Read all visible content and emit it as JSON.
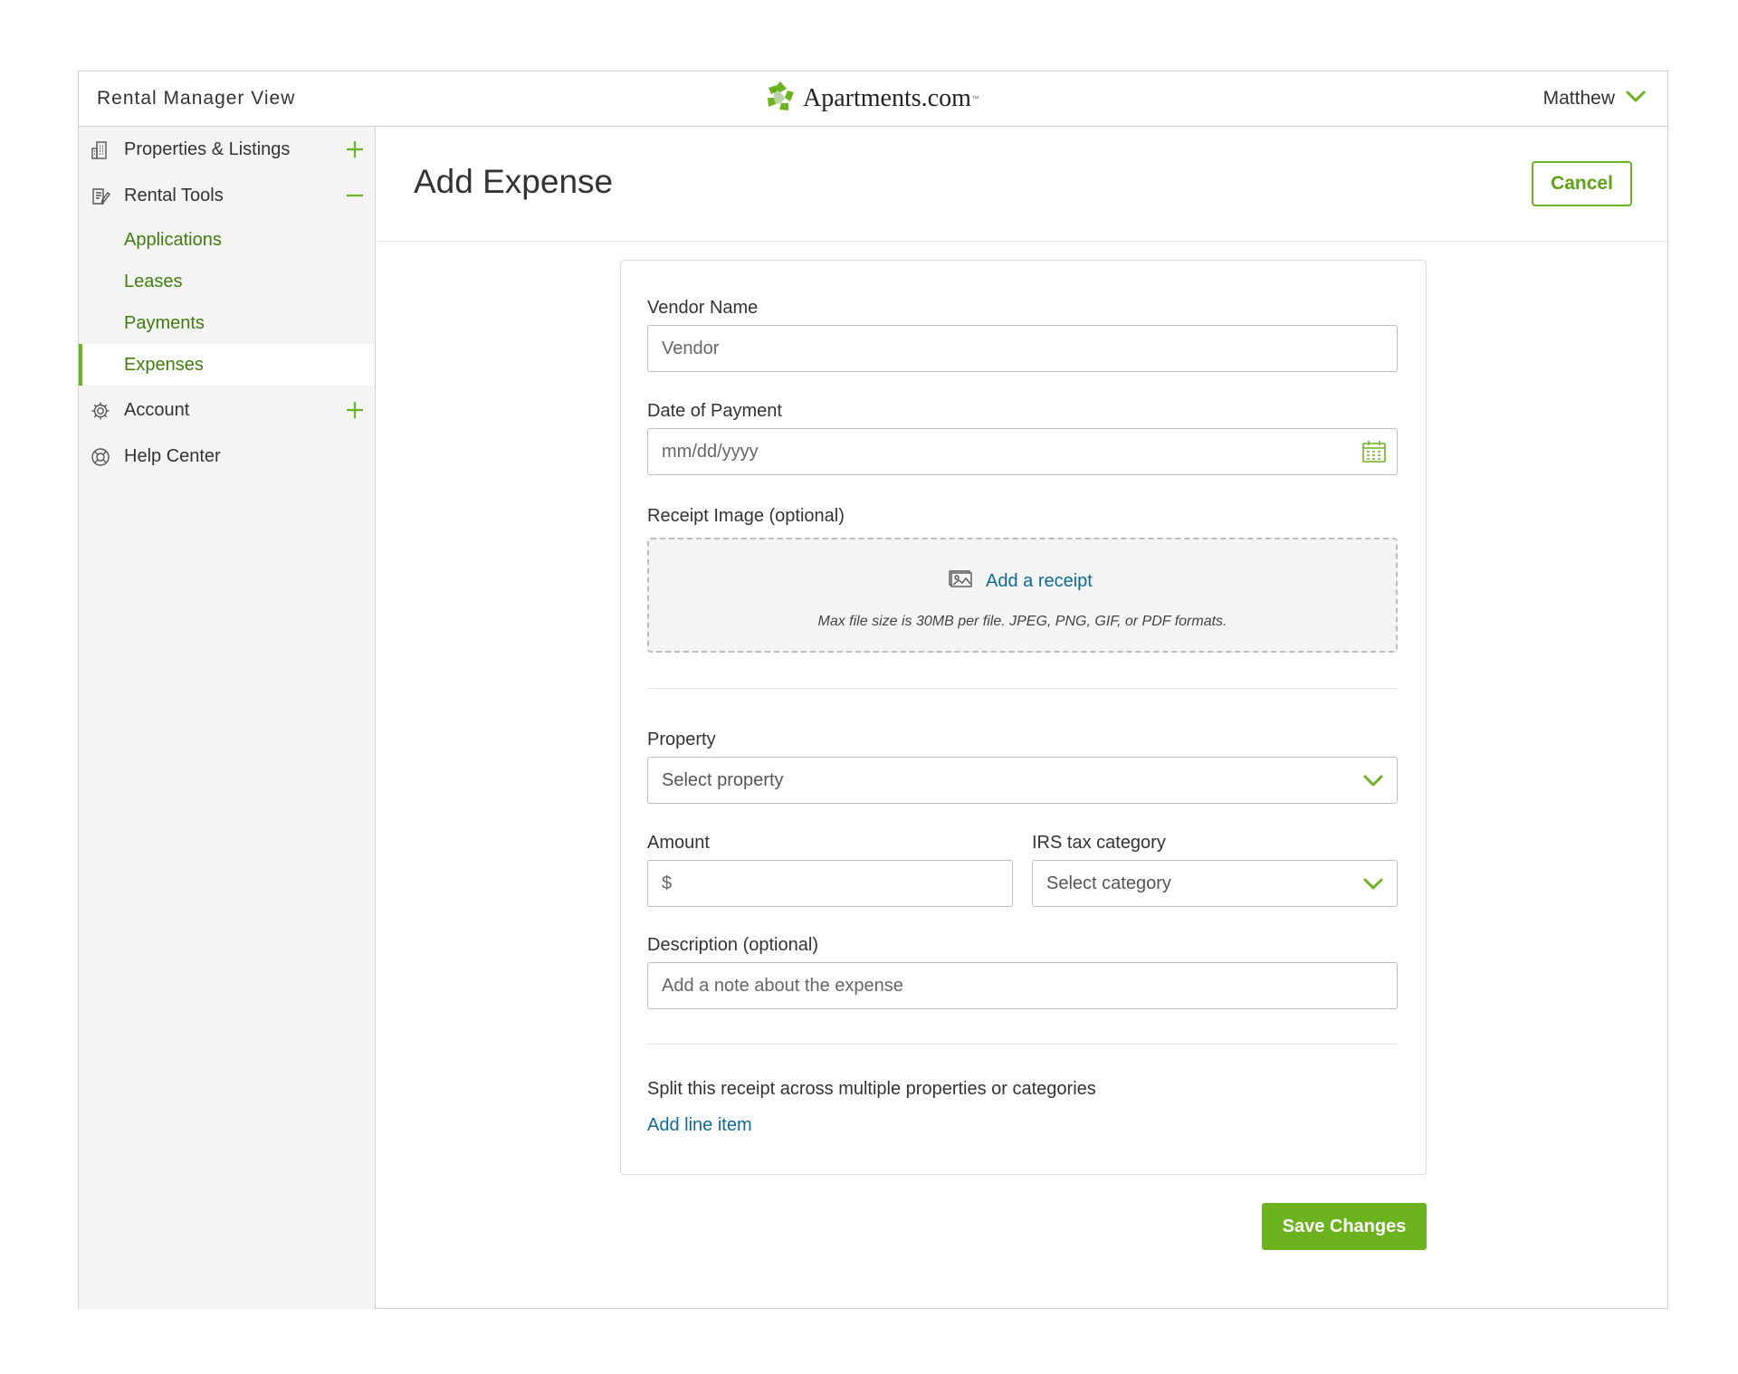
{
  "header": {
    "app_title": "Rental Manager View",
    "logo_text": "Apartments.com",
    "logo_tm": "™",
    "user_name": "Matthew"
  },
  "sidebar": {
    "items": [
      {
        "label": "Properties & Listings",
        "icon": "building-icon",
        "toggle": "plus"
      },
      {
        "label": "Rental Tools",
        "icon": "document-edit-icon",
        "toggle": "minus",
        "subitems": [
          "Applications",
          "Leases",
          "Payments",
          "Expenses"
        ],
        "active_subitem": "Expenses"
      },
      {
        "label": "Account",
        "icon": "gear-icon",
        "toggle": "plus"
      },
      {
        "label": "Help Center",
        "icon": "lifebuoy-icon"
      }
    ]
  },
  "main": {
    "title": "Add Expense",
    "cancel_label": "Cancel",
    "save_label": "Save Changes"
  },
  "form": {
    "vendor": {
      "label": "Vendor Name",
      "placeholder": "Vendor"
    },
    "date": {
      "label": "Date of Payment",
      "placeholder": "mm/dd/yyyy"
    },
    "receipt": {
      "label": "Receipt Image (optional)",
      "link": "Add a receipt",
      "note": "Max file size is 30MB per file. JPEG, PNG, GIF, or PDF formats."
    },
    "property": {
      "label": "Property",
      "selected": "Select property"
    },
    "amount": {
      "label": "Amount",
      "placeholder": "$"
    },
    "irs": {
      "label": "IRS tax category",
      "selected": "Select category"
    },
    "description": {
      "label": "Description (optional)",
      "placeholder": "Add a note about the expense"
    },
    "split_text": "Split this receipt across multiple properties or categories",
    "add_line_label": "Add line item"
  },
  "colors": {
    "accent_green": "#6db31f",
    "nav_green": "#3f7d0d",
    "link_blue": "#0c6a9c"
  }
}
